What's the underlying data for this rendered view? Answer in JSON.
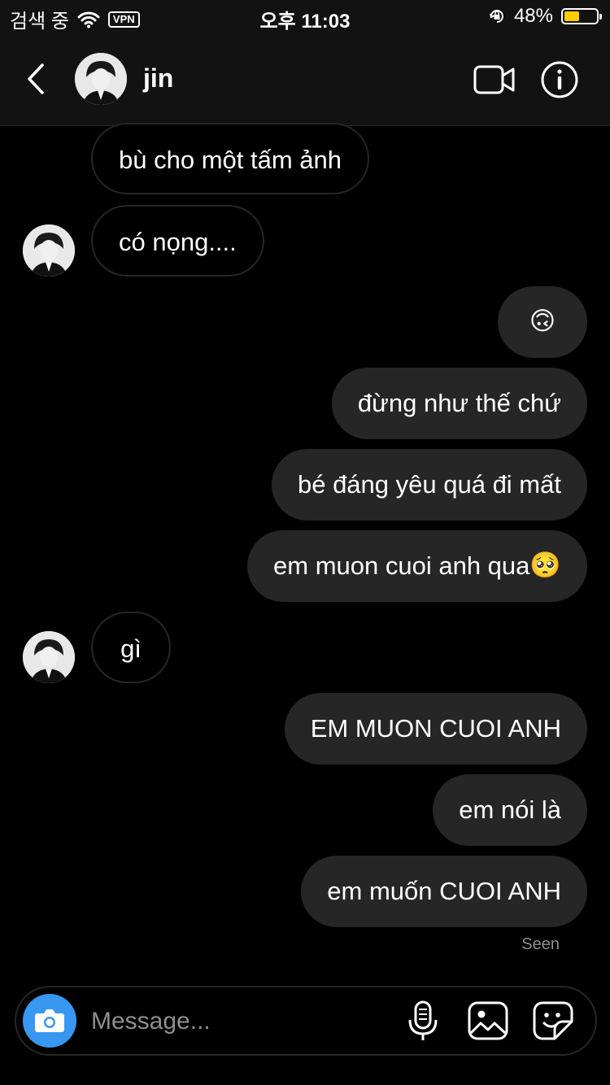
{
  "status_bar": {
    "carrier": "검색 중",
    "vpn": "VPN",
    "time": "오후 11:03",
    "battery": "48%",
    "battery_level": 0.48
  },
  "header": {
    "name": "jin",
    "icons": [
      "back-icon",
      "video-call-icon",
      "info-icon"
    ]
  },
  "messages": [
    {
      "text": "bù cho một tấm ảnh",
      "from": "them"
    },
    {
      "text": "có nọng....",
      "from": "them"
    },
    {
      "text": "🙃",
      "from": "me"
    },
    {
      "text": "đừng như thế chứ",
      "from": "me"
    },
    {
      "text": "bé đáng yêu quá đi mất",
      "from": "me"
    },
    {
      "text": "em muon cuoi anh qua",
      "emoji": "🥺",
      "from": "me"
    },
    {
      "text": "gì",
      "from": "them"
    },
    {
      "text": "EM MUON CUOI ANH",
      "from": "me"
    },
    {
      "text": "em nói là",
      "from": "me"
    },
    {
      "text": "em muốn CUOI ANH",
      "from": "me"
    }
  ],
  "seen_label": "Seen",
  "composer": {
    "placeholder": "Message...",
    "icons": [
      "camera-icon",
      "microphone-icon",
      "gallery-icon",
      "sticker-icon"
    ]
  },
  "colors": {
    "background": "#000000",
    "header": "#121212",
    "outgoing_bubble": "#262626",
    "camera_button": "#3897f0",
    "battery": "#ffcc00"
  }
}
